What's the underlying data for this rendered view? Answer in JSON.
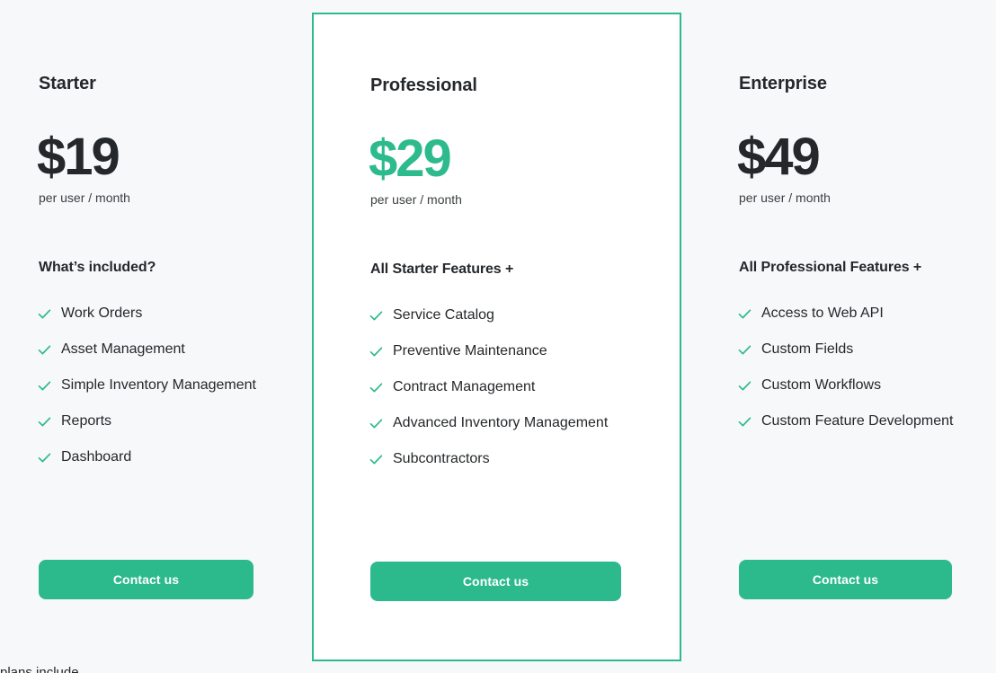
{
  "page": {
    "background_color": "#f7f8f9",
    "accent_color": "#2cba8c",
    "text_color": "#25282b",
    "footnote": "plans include"
  },
  "plans": [
    {
      "name": "Starter",
      "price": "$19",
      "price_is_accent": false,
      "period": "per user / month",
      "features_title": "What’s included?",
      "features": [
        "Work Orders",
        "Asset Management",
        "Simple Inventory Management",
        "Reports",
        "Dashboard"
      ],
      "cta_label": "Contact us",
      "featured": false
    },
    {
      "name": "Professional",
      "price": "$29",
      "price_is_accent": true,
      "period": "per user / month",
      "features_title": "All Starter Features +",
      "features": [
        "Service Catalog",
        "Preventive Maintenance",
        "Contract Management",
        "Advanced Inventory Management",
        "Subcontractors"
      ],
      "cta_label": "Contact us",
      "featured": true
    },
    {
      "name": "Enterprise",
      "price": "$49",
      "price_is_accent": false,
      "period": "per user / month",
      "features_title": "All Professional Features +",
      "features": [
        "Access to Web API",
        "Custom Fields",
        "Custom Workflows",
        "Custom Feature Development"
      ],
      "cta_label": "Contact us",
      "featured": false
    }
  ],
  "icons": {
    "check": "check-icon"
  }
}
